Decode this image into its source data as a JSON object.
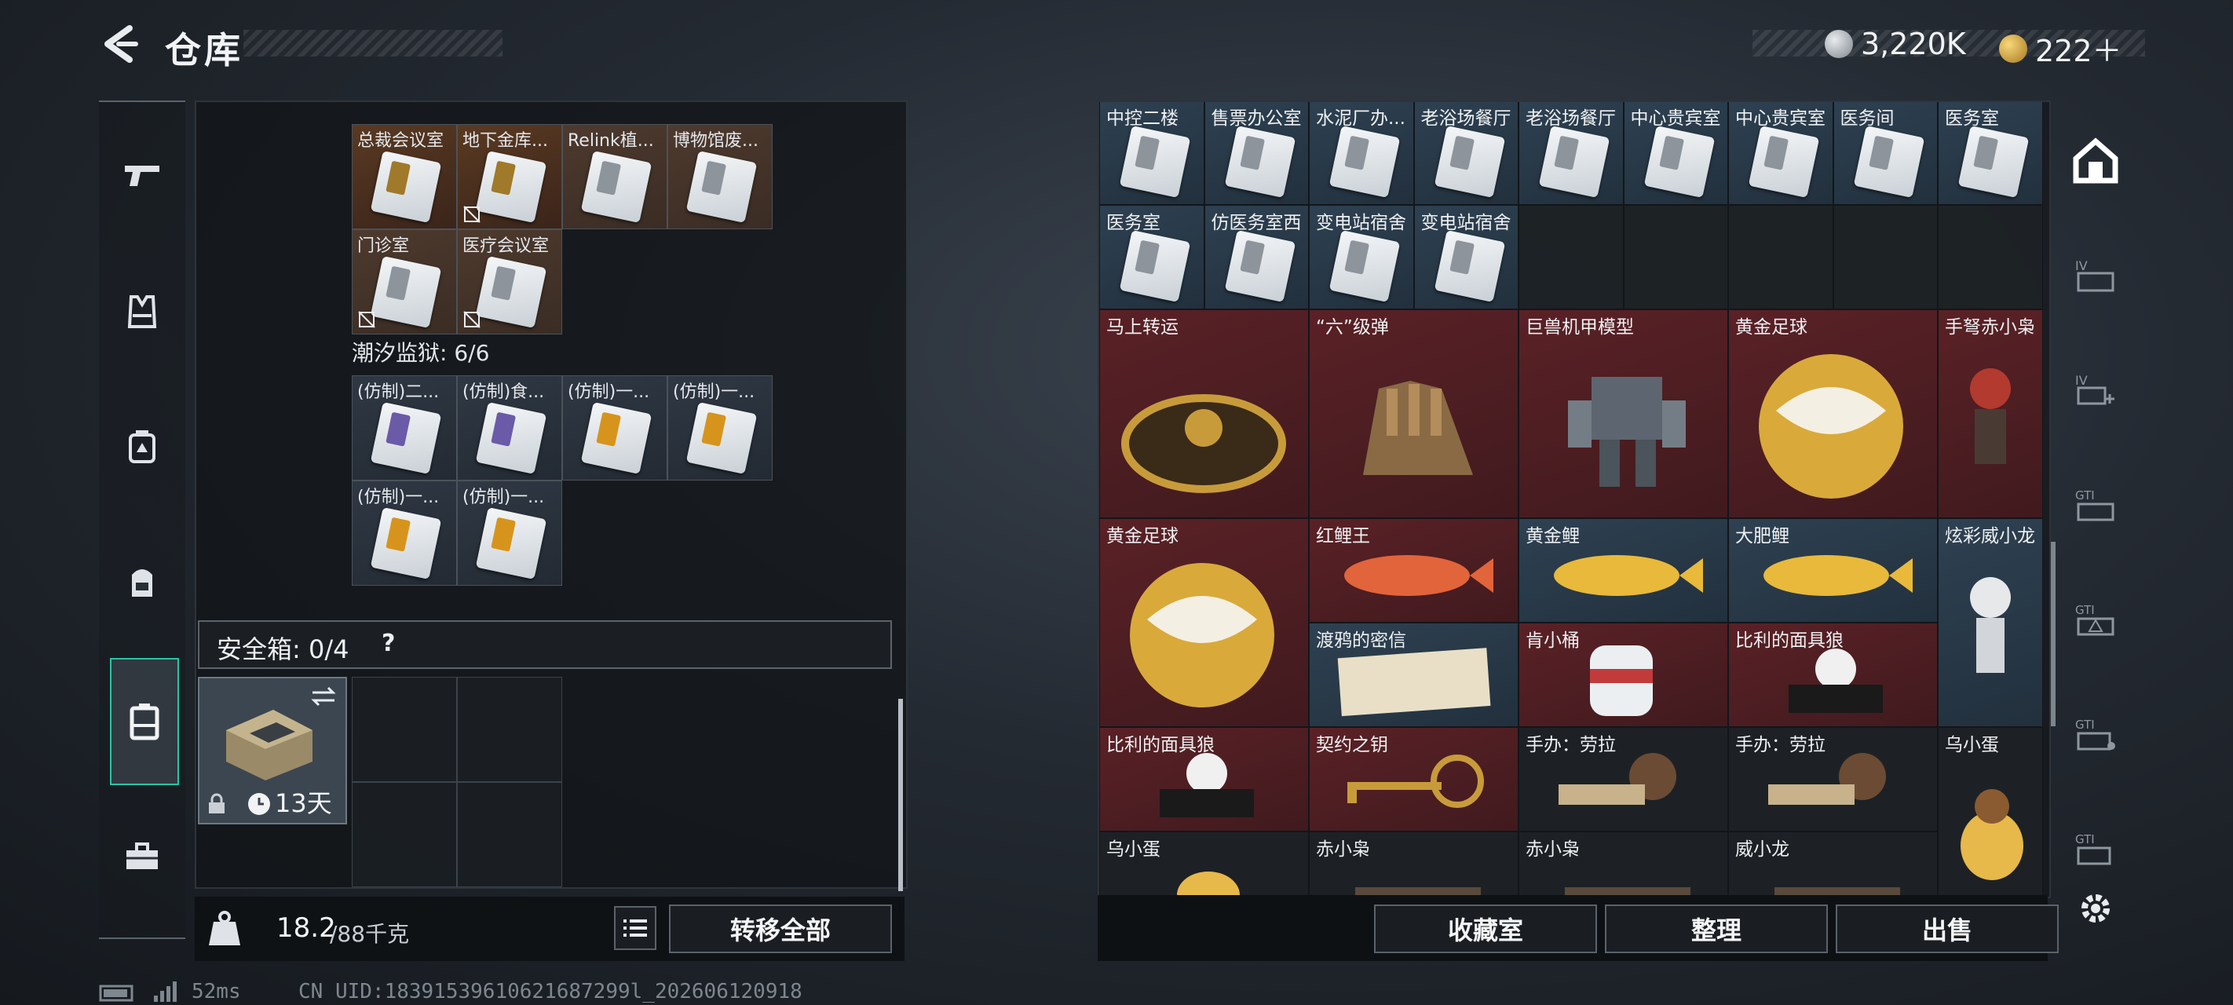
{
  "header": {
    "title": "仓库",
    "currency1_value": "3,220K",
    "currency2_value": "222＋"
  },
  "left_panel": {
    "top_cells": [
      {
        "label": "总裁会议室",
        "bg": "gold",
        "card": "gold",
        "no_limit": false
      },
      {
        "label": "地下金库...",
        "bg": "gold",
        "card": "gold",
        "no_limit": true
      },
      {
        "label": "Relink植...",
        "bg": "brown",
        "card": "plain",
        "no_limit": false
      },
      {
        "label": "博物馆废...",
        "bg": "brown",
        "card": "plain",
        "no_limit": false
      },
      {
        "label": "门诊室",
        "bg": "brown",
        "card": "plain",
        "no_limit": true
      },
      {
        "label": "医疗会议室",
        "bg": "brown",
        "card": "plain",
        "no_limit": true
      }
    ],
    "section_prison": "潮汐监狱: 6/6",
    "prison_cells": [
      {
        "label": "(仿制)二...",
        "card": "purple"
      },
      {
        "label": "(仿制)食...",
        "card": "purple"
      },
      {
        "label": "(仿制)一...",
        "card": "orange"
      },
      {
        "label": "(仿制)一...",
        "card": "orange"
      },
      {
        "label": "(仿制)一...",
        "card": "orange"
      },
      {
        "label": "(仿制)一...",
        "card": "orange"
      }
    ],
    "safebox_label": "安全箱: 0/4",
    "safebox_help": "?",
    "safebox_days": "13天",
    "weight_value": "18.2",
    "weight_max": "/88千克",
    "transfer_all": "转移全部"
  },
  "right_panel": {
    "row1": [
      "中控二楼",
      "售票办公室",
      "水泥厂办...",
      "老浴场餐厅",
      "老浴场餐厅",
      "中心贵宾室",
      "中心贵宾室",
      "医务间",
      "医务室"
    ],
    "row2": [
      "医务室",
      "仿医务室西",
      "变电站宿舍",
      "变电站宿舍"
    ],
    "items": {
      "mashangzhuanyun": "马上转运",
      "liujidan": "“六”级弹",
      "jushoujijia": "巨兽机甲模型",
      "huangjinzuqiu1": "黄金足球",
      "shounu": "手弩赤小枭",
      "huangjinzuqiu2": "黄金足球",
      "hongliwang": "红鲤王",
      "huangjinli": "黄金鲤",
      "dafeili": "大肥鲤",
      "xuancai": "炫彩威小龙",
      "duya": "渡鸦的密信",
      "kenxiaotong": "肯小桶",
      "bili1": "比利的面具狼",
      "bili2": "比利的面具狼",
      "qiyue": "契约之钥",
      "shouban1": "手办：劳拉",
      "shouban2": "手办：劳拉",
      "wuxiaodan1": "乌小蛋",
      "wuxiaodan2": "乌小蛋",
      "chixiaoxiao1": "赤小枭",
      "chixiaoxiao2": "赤小枭",
      "weixiaolong": "威小龙"
    },
    "btn_collection": "收藏室",
    "btn_sort": "整理",
    "btn_sell": "出售"
  },
  "status": {
    "ping": "52ms",
    "uid": "CN UID:18391539610621687299l_202606120918"
  },
  "colors": {
    "accent_teal": "#27c6a5",
    "cell_red": "#5a2126",
    "cell_blue": "#2e4152"
  }
}
